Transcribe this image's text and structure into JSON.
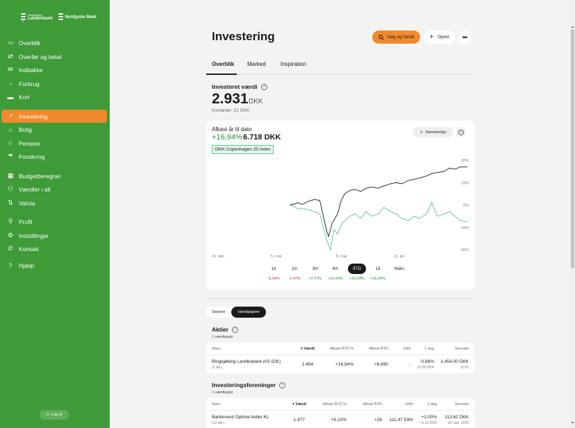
{
  "brand": {
    "logo1_small": "Ringkjøbing",
    "logo1_name": "Landbobank",
    "logo2_name": "Nordjyske Bank"
  },
  "colors": {
    "sidebar": "#3e9b38",
    "accent": "#f08a2c",
    "positive": "#2a8a3a",
    "negative": "#c0392b",
    "index_line": "#5ac48a"
  },
  "sidebar": {
    "items": [
      {
        "label": "Overblik",
        "icon": "dashboard-icon"
      },
      {
        "label": "Overfør og betal",
        "icon": "transfer-icon"
      },
      {
        "label": "Indbakke",
        "icon": "mail-icon"
      },
      {
        "label": "Forbrug",
        "icon": "pie-chart-icon"
      },
      {
        "label": "Kort",
        "icon": "card-icon"
      },
      {
        "label": "Investering",
        "icon": "trend-icon",
        "active": true
      },
      {
        "label": "Bolig",
        "icon": "home-icon"
      },
      {
        "label": "Pension",
        "icon": "pension-icon"
      },
      {
        "label": "Forsikring",
        "icon": "umbrella-icon"
      },
      {
        "label": "Budgetberegner",
        "icon": "calculator-icon"
      },
      {
        "label": "Værdier i alt",
        "icon": "values-icon"
      },
      {
        "label": "Valuta",
        "icon": "currency-icon"
      },
      {
        "label": "Profil",
        "icon": "user-icon"
      },
      {
        "label": "Indstillinger",
        "icon": "gear-icon"
      },
      {
        "label": "Kontakt",
        "icon": "phone-icon"
      },
      {
        "label": "Hjælp",
        "icon": "help-icon"
      }
    ],
    "logout_label": "Log af"
  },
  "header": {
    "title": "Investering",
    "search_label": "Søg og handl",
    "create_label": "Opret",
    "more_label": "•••"
  },
  "tabs": [
    "Overblik",
    "Marked",
    "Inspiration"
  ],
  "invested": {
    "label": "Investeret værdi",
    "value": "2.931",
    "currency": "DKK",
    "accounts": "Kontanter: 51 DKK"
  },
  "return_card": {
    "title": "Afkast år til dato",
    "pct": "+16,94%",
    "amount": "6.718 DKK",
    "index_label": "OMX Copenhagen 25 Index",
    "compare_label": "Sammenlign",
    "periods": [
      {
        "label": "1d",
        "ret": "-0,34%",
        "dir": "neg"
      },
      {
        "label": "1m",
        "ret": "-1,47%",
        "dir": "neg"
      },
      {
        "label": "3m",
        "ret": "+7,07%",
        "dir": "pos"
      },
      {
        "label": "6m",
        "ret": "+16,94%",
        "dir": "pos"
      },
      {
        "label": "ÅTD",
        "ret": "+16,94%",
        "dir": "pos",
        "active": true
      },
      {
        "label": "1å",
        "ret": "+16,94%",
        "dir": "pos"
      },
      {
        "label": "Maks",
        "ret": "",
        "dir": "pos"
      }
    ]
  },
  "chart_data": {
    "type": "line",
    "x_ticks": [
      "31. dec.",
      "5. mar.",
      "8. maj",
      "11. jul."
    ],
    "y_ticks": [
      "20%",
      "10%",
      "0%",
      "-10%",
      "-20%"
    ],
    "ylim": [
      -20,
      20
    ],
    "x_range": [
      0,
      100
    ],
    "series": [
      {
        "color": "#1a1a1a",
        "x": [
          0,
          3,
          5,
          7,
          10,
          14,
          17,
          19,
          21,
          22,
          24,
          27,
          29,
          31,
          34,
          37,
          40,
          43,
          46,
          50,
          53,
          57,
          60,
          63,
          67,
          70,
          73,
          77,
          80,
          83,
          87,
          90,
          93,
          96,
          100
        ],
        "values": [
          0,
          0.5,
          1,
          0.2,
          1.5,
          2.5,
          2,
          -5,
          -12,
          -14,
          -8,
          -4,
          2,
          5,
          6.5,
          7,
          6,
          7.5,
          8,
          7.5,
          8.5,
          9.5,
          10,
          9.5,
          11,
          11.5,
          12,
          13,
          14,
          14.5,
          15,
          16.5,
          16,
          17,
          17
        ]
      },
      {
        "color": "#5ac48a",
        "x": [
          0,
          3,
          5,
          7,
          10,
          14,
          17,
          19,
          21,
          23,
          25,
          27,
          29,
          31,
          34,
          37,
          40,
          43,
          46,
          50,
          53,
          57,
          60,
          63,
          67,
          70,
          73,
          77,
          80,
          83,
          87,
          90,
          93,
          96,
          100
        ],
        "values": [
          0,
          -1,
          -2,
          -1.5,
          -2,
          -3,
          -4,
          -10,
          -16,
          -20,
          -11,
          -13,
          -9,
          -7,
          -5,
          -4,
          -6,
          -3,
          -5,
          -4,
          -1,
          -3,
          -4,
          -6,
          -7,
          -5,
          -6,
          -4,
          1,
          -5,
          -4,
          -3,
          -5,
          -7,
          -7.5
        ]
      }
    ]
  },
  "holdings_toggle": [
    "Depoter",
    "Værdipapirer"
  ],
  "stocks": {
    "title": "Aktier",
    "count": "1 værdipapir",
    "headers": [
      "Navn",
      "Værdi",
      "Afkast ÅTD %",
      "Afkast ÅTD",
      "GAK",
      "1 dag",
      "Seneste"
    ],
    "rows": [
      {
        "name": "Ringkjøbing Landbobank A/S (DK)",
        "qty": "(1 stk.)",
        "value": "1.454",
        "ret_pct": "+16,94%",
        "ret_amt": "+6.690",
        "gak": "-",
        "day_pct": "-0,68%",
        "day_amt": "-10,00 DKK",
        "latest": "1.454,00 DKK",
        "latest_time": "11:03"
      }
    ]
  },
  "funds": {
    "title": "Investeringsforeninger",
    "count": "1 værdipapir",
    "headers": [
      "Navn",
      "Værdi",
      "Afkast ÅTD %",
      "Afkast ÅTD",
      "GAK",
      "1 dag",
      "Seneste"
    ],
    "rows": [
      {
        "name": "Bankinvest Optima Aktier KL",
        "qty": "(13 stk.)",
        "value": "1.477",
        "ret_pct": "+5,10%",
        "ret_amt": "+28",
        "gak": "111,47 DKK",
        "day_pct": "+1,00%",
        "day_amt": "+1,12 DKK",
        "latest": "113,62 DKK",
        "latest_time": "10. sep. 2025"
      }
    ]
  }
}
